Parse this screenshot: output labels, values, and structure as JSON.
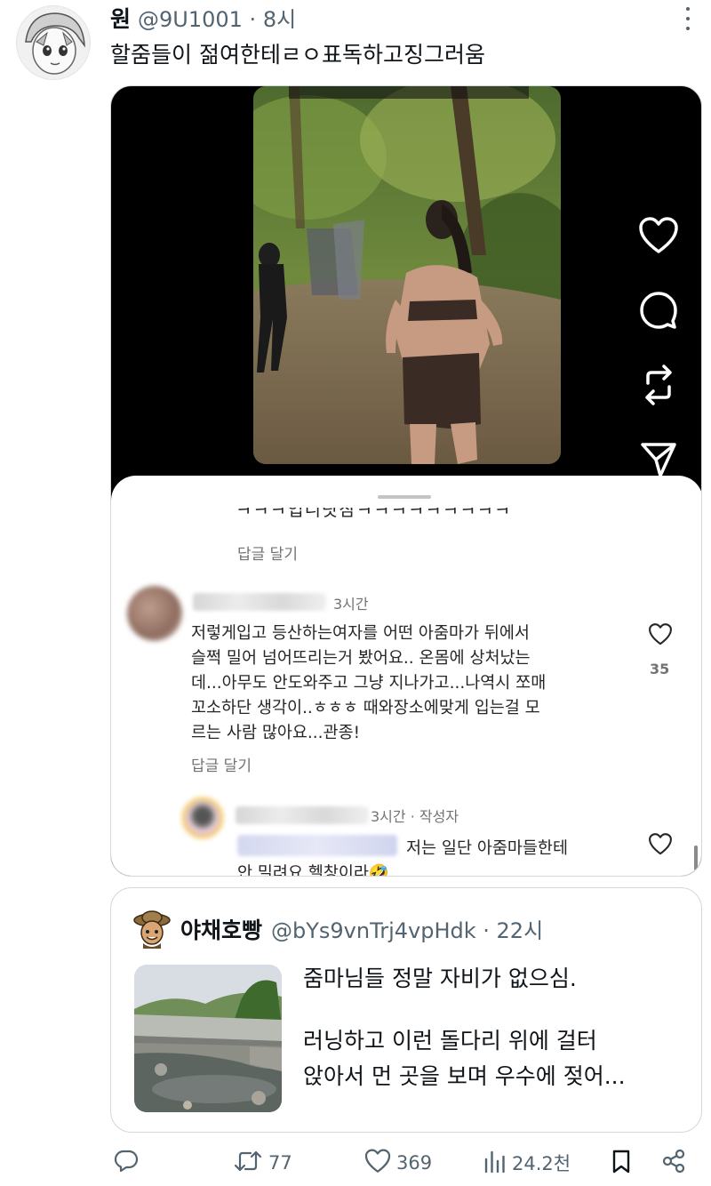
{
  "tweet": {
    "author_name": "원",
    "author_handle": "@9U1001 · 8시",
    "text": "할줌들이 젊여한테ㄹㅇ표독하고징그러움"
  },
  "media": {
    "comment_sheet": {
      "cut_text": "ㅋㅋㅋ입니닷참ㅋㅋㅋㅋㅋㅋㅋㅋㅋ",
      "reply_label_1": "답글 달기",
      "comment": {
        "time": "3시간",
        "lines": [
          "저렇게입고 등산하는여자를 어떤 아줌마가 뒤에서",
          "슬쩍 밀어 넘어뜨리는거 봤어요.. 온몸에 상처났는",
          "데...아무도 안도와주고 그냥 지나가고...나역시 쪼매",
          "꼬소하단 생각이..ㅎㅎㅎ  때와장소에맞게 입는걸 모",
          "르는 사람 많아요...관종!"
        ],
        "likes": "35",
        "reply_label": "답글 달기"
      },
      "reply": {
        "meta": "3시간 · 작성자",
        "lines": [
          "저는 일단 아줌마들한테",
          "안 밀려요 헬창이라🤣"
        ]
      }
    }
  },
  "quote": {
    "author_name": "야채호빵",
    "author_handle": "@bYs9vnTrj4vpHdk · 22시",
    "line1": "줌마님들 정말 자비가 없으심.",
    "line2": "러닝하고 이런 돌다리 위에 걸터",
    "line3": "앉아서 먼 곳을 보며 우수에 젖어..."
  },
  "actions": {
    "retweets": "77",
    "likes": "369",
    "views": "24.2천"
  },
  "colors": {
    "text_primary": "#0f1419",
    "text_secondary": "#536471",
    "border": "#cfd9de",
    "sheet_text": "#262626",
    "sheet_meta": "#737373"
  },
  "icons": [
    "more-icon",
    "heart-icon",
    "comment-bubble-icon",
    "repost-icon",
    "send-icon",
    "reply-icon",
    "retweet-icon",
    "like-icon",
    "views-icon",
    "bookmark-icon",
    "share-icon"
  ]
}
